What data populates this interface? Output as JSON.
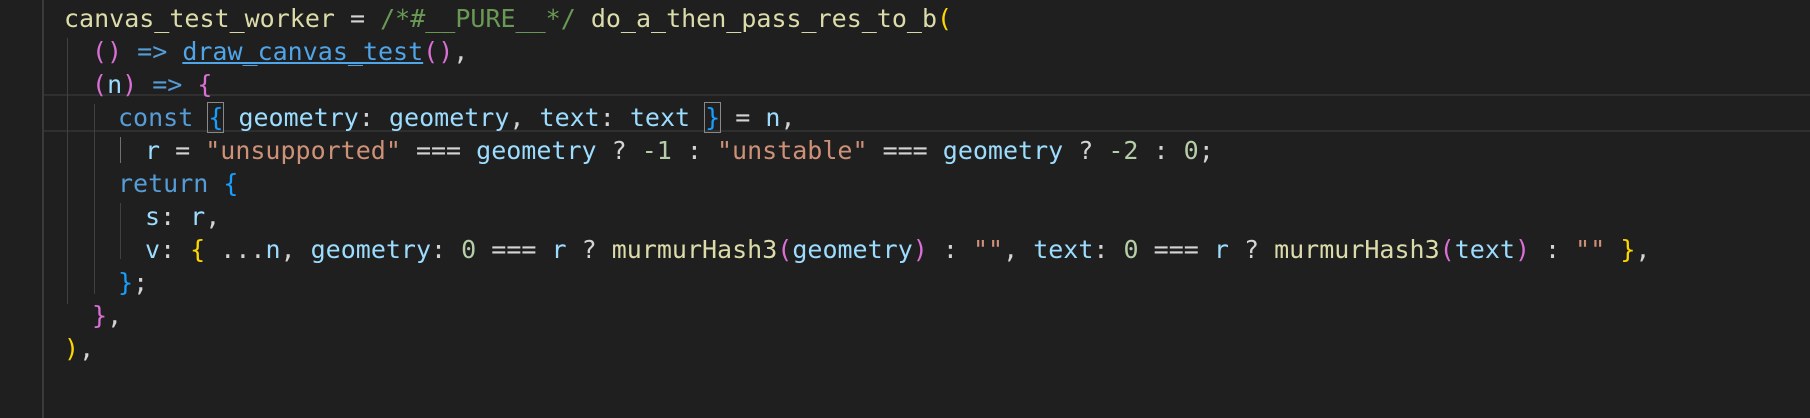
{
  "lines": [
    [
      "canvas_test_worker",
      " = ",
      "/*#__PURE__*/",
      " ",
      "do_a_then_pass_res_to_b",
      "("
    ],
    [
      "()",
      " => ",
      "draw_canvas_test",
      "()",
      ","
    ],
    [
      "(",
      "n",
      ")",
      " => ",
      "{"
    ],
    [
      "const",
      " ",
      "{",
      " ",
      "geometry",
      ": ",
      "geometry",
      ", ",
      "text",
      ": ",
      "text",
      " ",
      "}",
      " = ",
      "n",
      ","
    ],
    [
      "r",
      " = ",
      "\"unsupported\"",
      " === ",
      "geometry",
      " ? ",
      "-1",
      " : ",
      "\"unstable\"",
      " === ",
      "geometry",
      " ? ",
      "-2",
      " : ",
      "0",
      ";"
    ],
    [
      "return",
      " ",
      "{"
    ],
    [
      "s",
      ": ",
      "r",
      ","
    ],
    [
      "v",
      ": ",
      "{",
      " ...",
      "n",
      ", ",
      "geometry",
      ": ",
      "0",
      " === ",
      "r",
      " ? ",
      "murmurHash3",
      "(",
      "geometry",
      ")",
      " : ",
      "\"\"",
      ", ",
      "text",
      ": ",
      "0",
      " === ",
      "r",
      " ? ",
      "murmurHash3",
      "(",
      "text",
      ")",
      " : ",
      "\"\"",
      " ",
      "}",
      ","
    ],
    [
      "}",
      ";"
    ],
    [
      "}",
      ","
    ],
    [
      ")",
      ","
    ]
  ]
}
